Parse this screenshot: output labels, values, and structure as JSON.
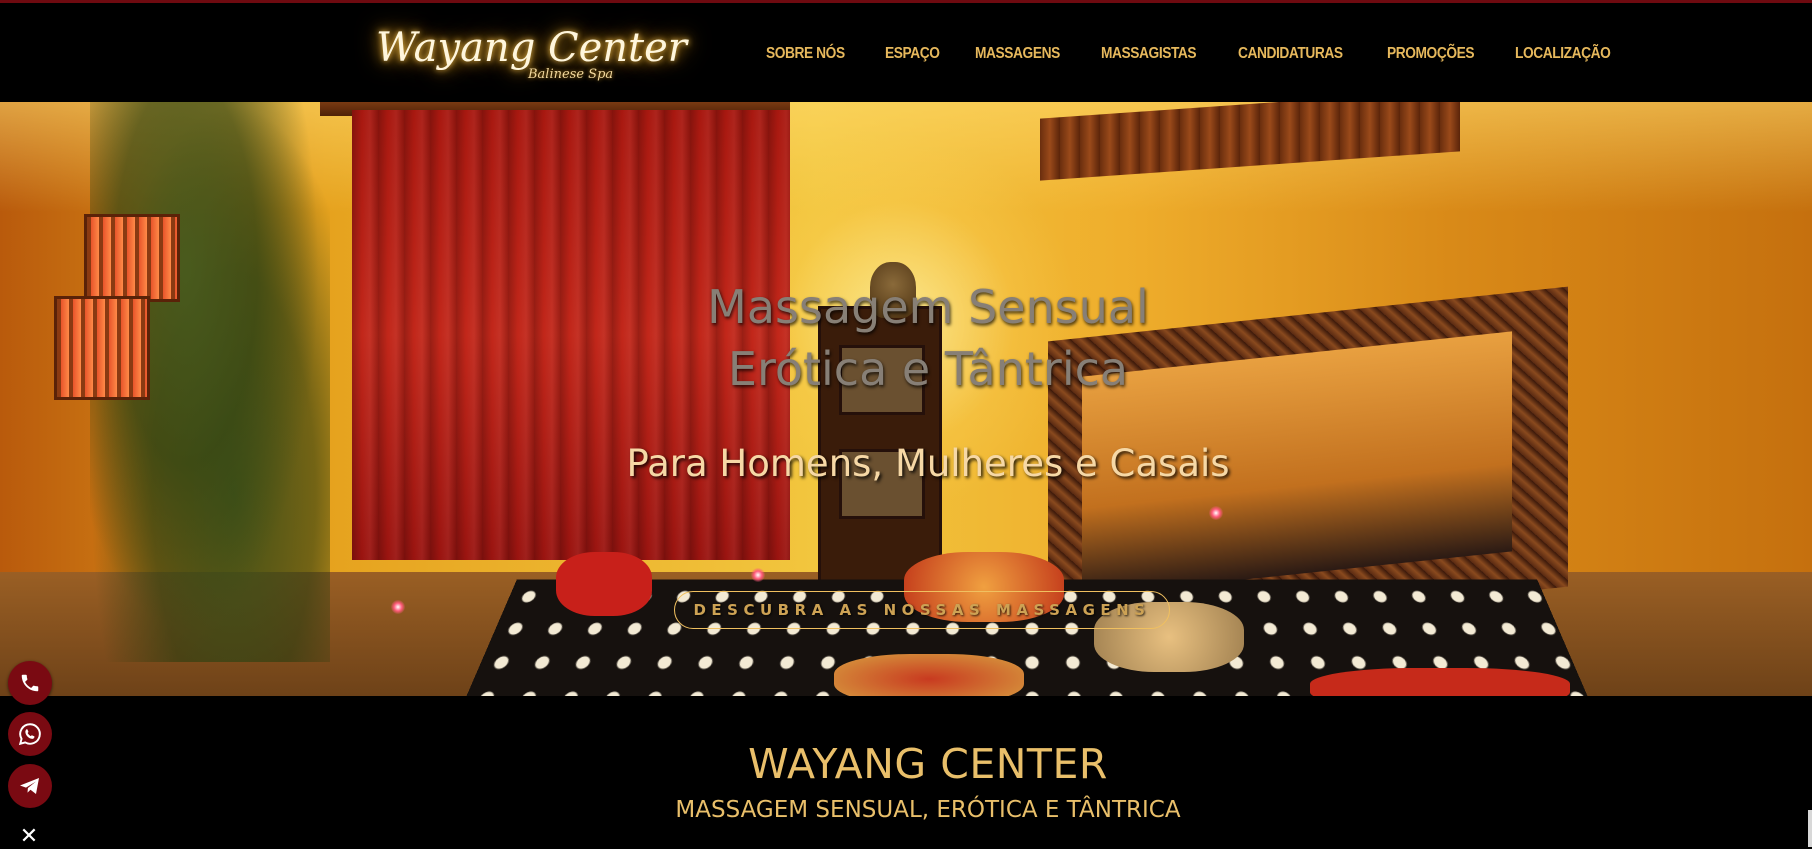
{
  "header": {
    "logo": {
      "name": "Wayang Center",
      "tagline": "Balinese Spa"
    },
    "nav": [
      {
        "label": "SOBRE NÓS"
      },
      {
        "label": "ESPAÇO"
      },
      {
        "label": "MASSAGENS"
      },
      {
        "label": "MASSAGISTAS"
      },
      {
        "label": "CANDIDATURAS"
      },
      {
        "label": "PROMOÇÕES"
      },
      {
        "label": "LOCALIZAÇÃO"
      }
    ]
  },
  "hero": {
    "title_line1": "Massagem Sensual",
    "title_line2": "Erótica e Tântrica",
    "subtitle": "Para Homens, Mulheres e Casais",
    "cta_label": "DESCUBRA AS NOSSAS MASSAGENS"
  },
  "intro": {
    "title": "WAYANG CENTER",
    "subtitle": "MASSAGEM SENSUAL, ERÓTICA E TÂNTRICA"
  },
  "contact_buttons": [
    {
      "icon": "phone-icon"
    },
    {
      "icon": "whatsapp-icon"
    },
    {
      "icon": "telegram-icon"
    }
  ],
  "close_glyph": "✕",
  "colors": {
    "accent": "#e6b85c",
    "header_border": "#6e0a10",
    "float_button": "#7a0a12",
    "heading_gold": "#e9bf6a"
  }
}
